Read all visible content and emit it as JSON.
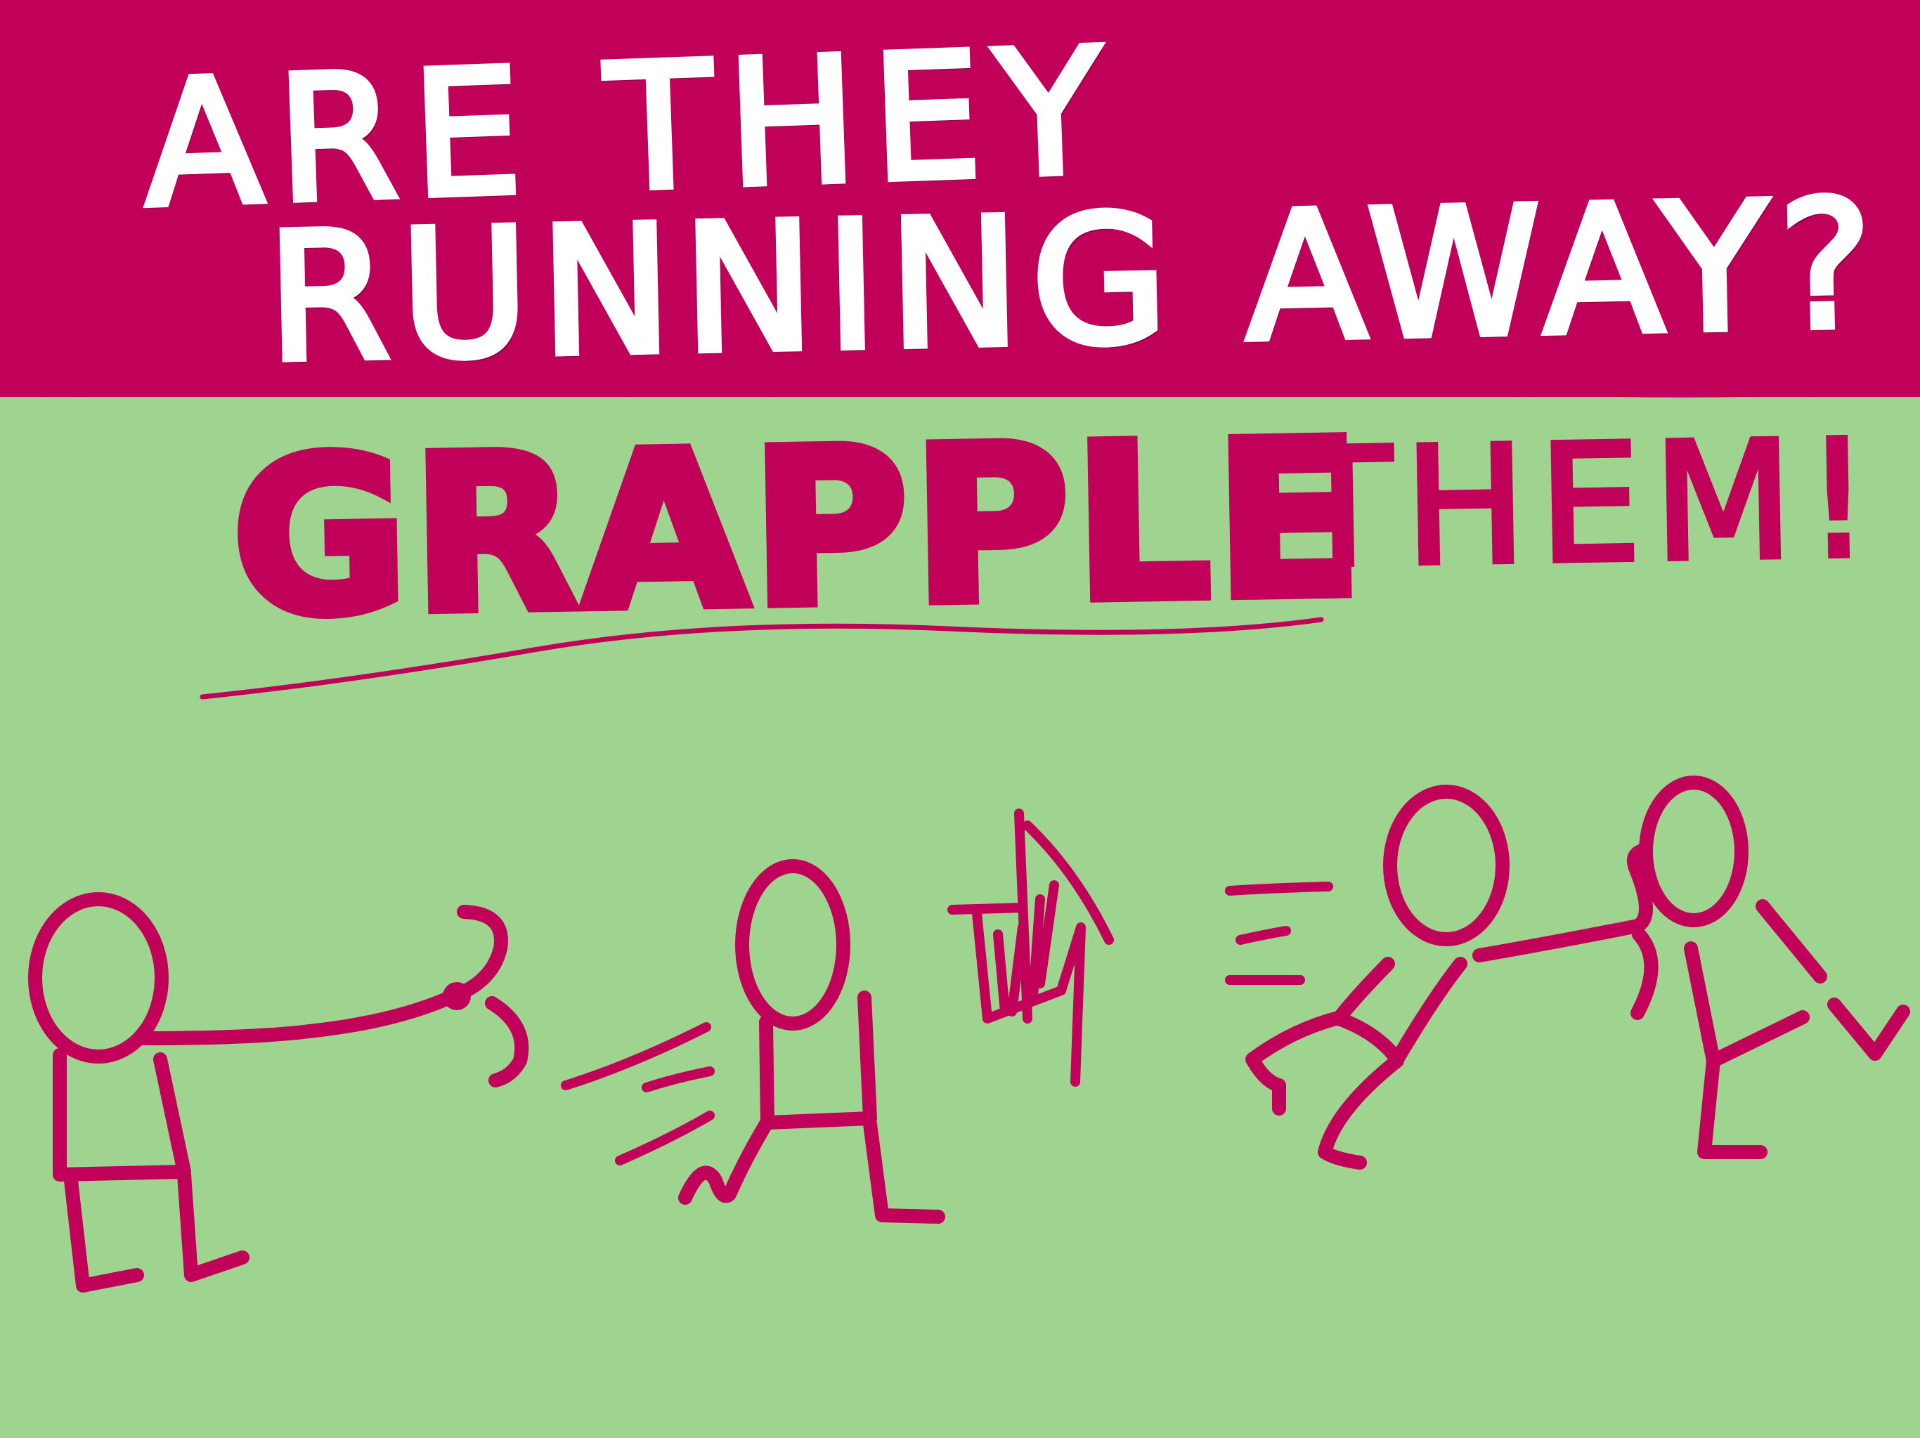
{
  "title": {
    "line1": "ARE THEY",
    "line2": "RUNNING AWAY?"
  },
  "headline": {
    "emphasis": "GRAPPLE",
    "rest": "THEM!"
  },
  "colors": {
    "banner": "#c10059",
    "background": "#9fd490",
    "ink": "#c10059",
    "title_text": "#ffffff"
  }
}
